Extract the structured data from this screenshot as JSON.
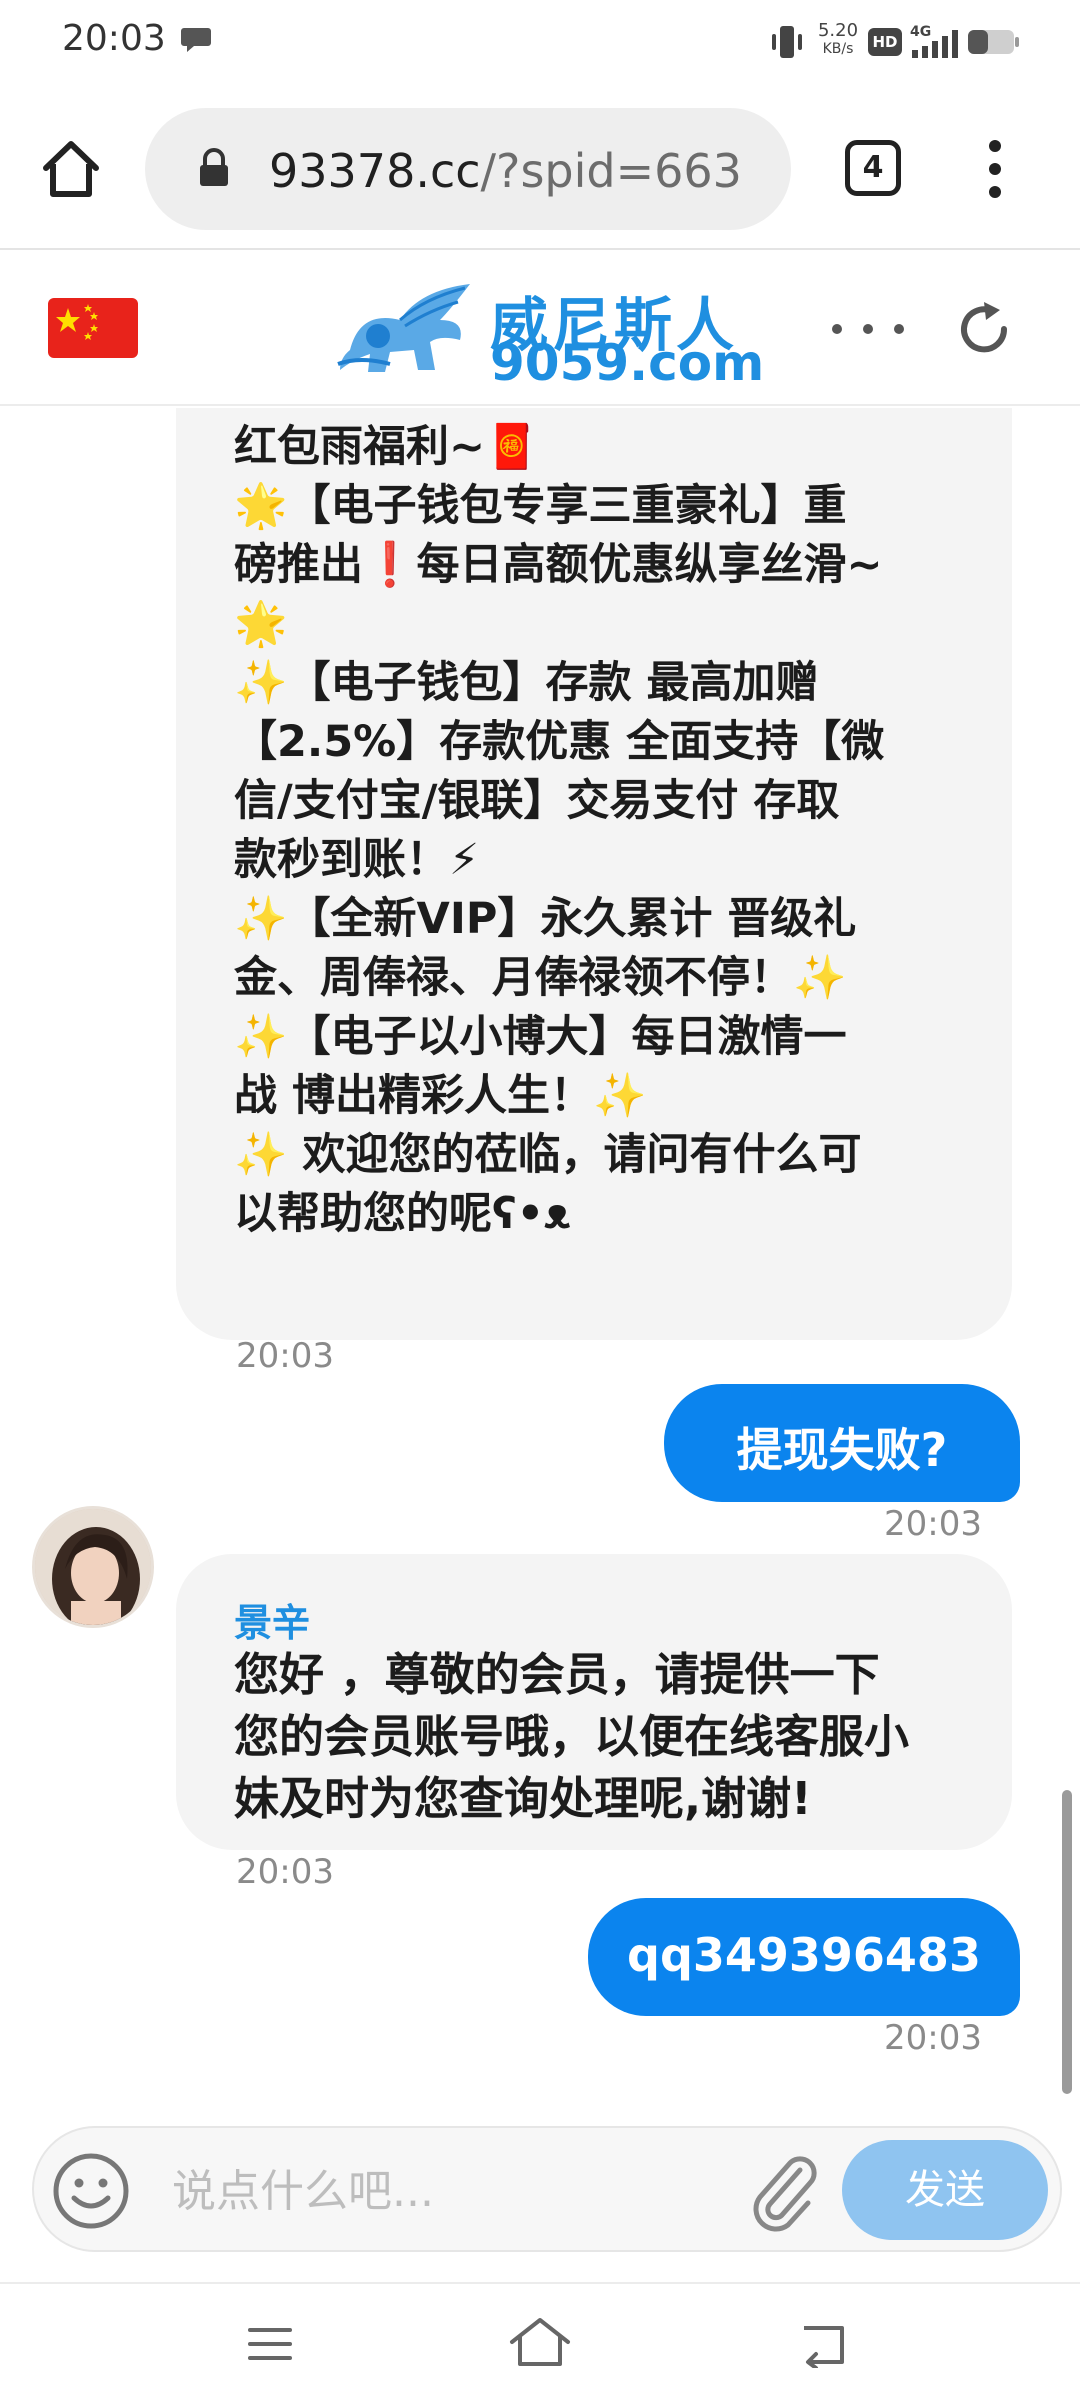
{
  "status_bar": {
    "time": "20:03",
    "net_speed_value": "5.20",
    "net_speed_unit": "KB/s",
    "hd": "HD",
    "network": "4G"
  },
  "browser": {
    "url_host": "93378.cc",
    "url_path": "/?spid=663",
    "tab_count": "4"
  },
  "site": {
    "logo_cn": "威尼斯人",
    "logo_en": "9059.com"
  },
  "chat": {
    "messages": [
      {
        "lines": [
          "红包雨福利~🧧",
          "🌟【电子钱包专享三重豪礼】重",
          "磅推出❗每日高额优惠纵享丝滑~",
          "🌟",
          "✨【电子钱包】存款 最高加赠",
          "【2.5%】存款优惠 全面支持【微",
          "信/支付宝/银联】交易支付  存取",
          "款秒到账！⚡",
          "✨【全新VIP】永久累计 晋级礼",
          "金、周俸禄、月俸禄领不停！✨",
          "✨【电子以小博大】每日激情一",
          "战 博出精彩人生！✨",
          "✨ 欢迎您的莅临，请问有什么可",
          "以帮助您的呢ʕ•ᴥ"
        ],
        "time": "20:03"
      },
      {
        "text": "提现失败?",
        "time": "20:03"
      },
      {
        "sender": "景辛",
        "lines": [
          "您好 ，尊敬的会员，请提供一下",
          "您的会员账号哦，以便在线客服小",
          "妹及时为您查询处理呢,谢谢!"
        ],
        "time": "20:03"
      },
      {
        "text": "qq349396483",
        "time": "20:03"
      }
    ]
  },
  "input": {
    "placeholder": "说点什么吧...",
    "send_label": "发送"
  },
  "colors": {
    "accent": "#0b84ee",
    "send_disabled": "#8fc4f0",
    "bubble_in": "#f4f4f4",
    "logo_blue": "#1f8fe0"
  }
}
